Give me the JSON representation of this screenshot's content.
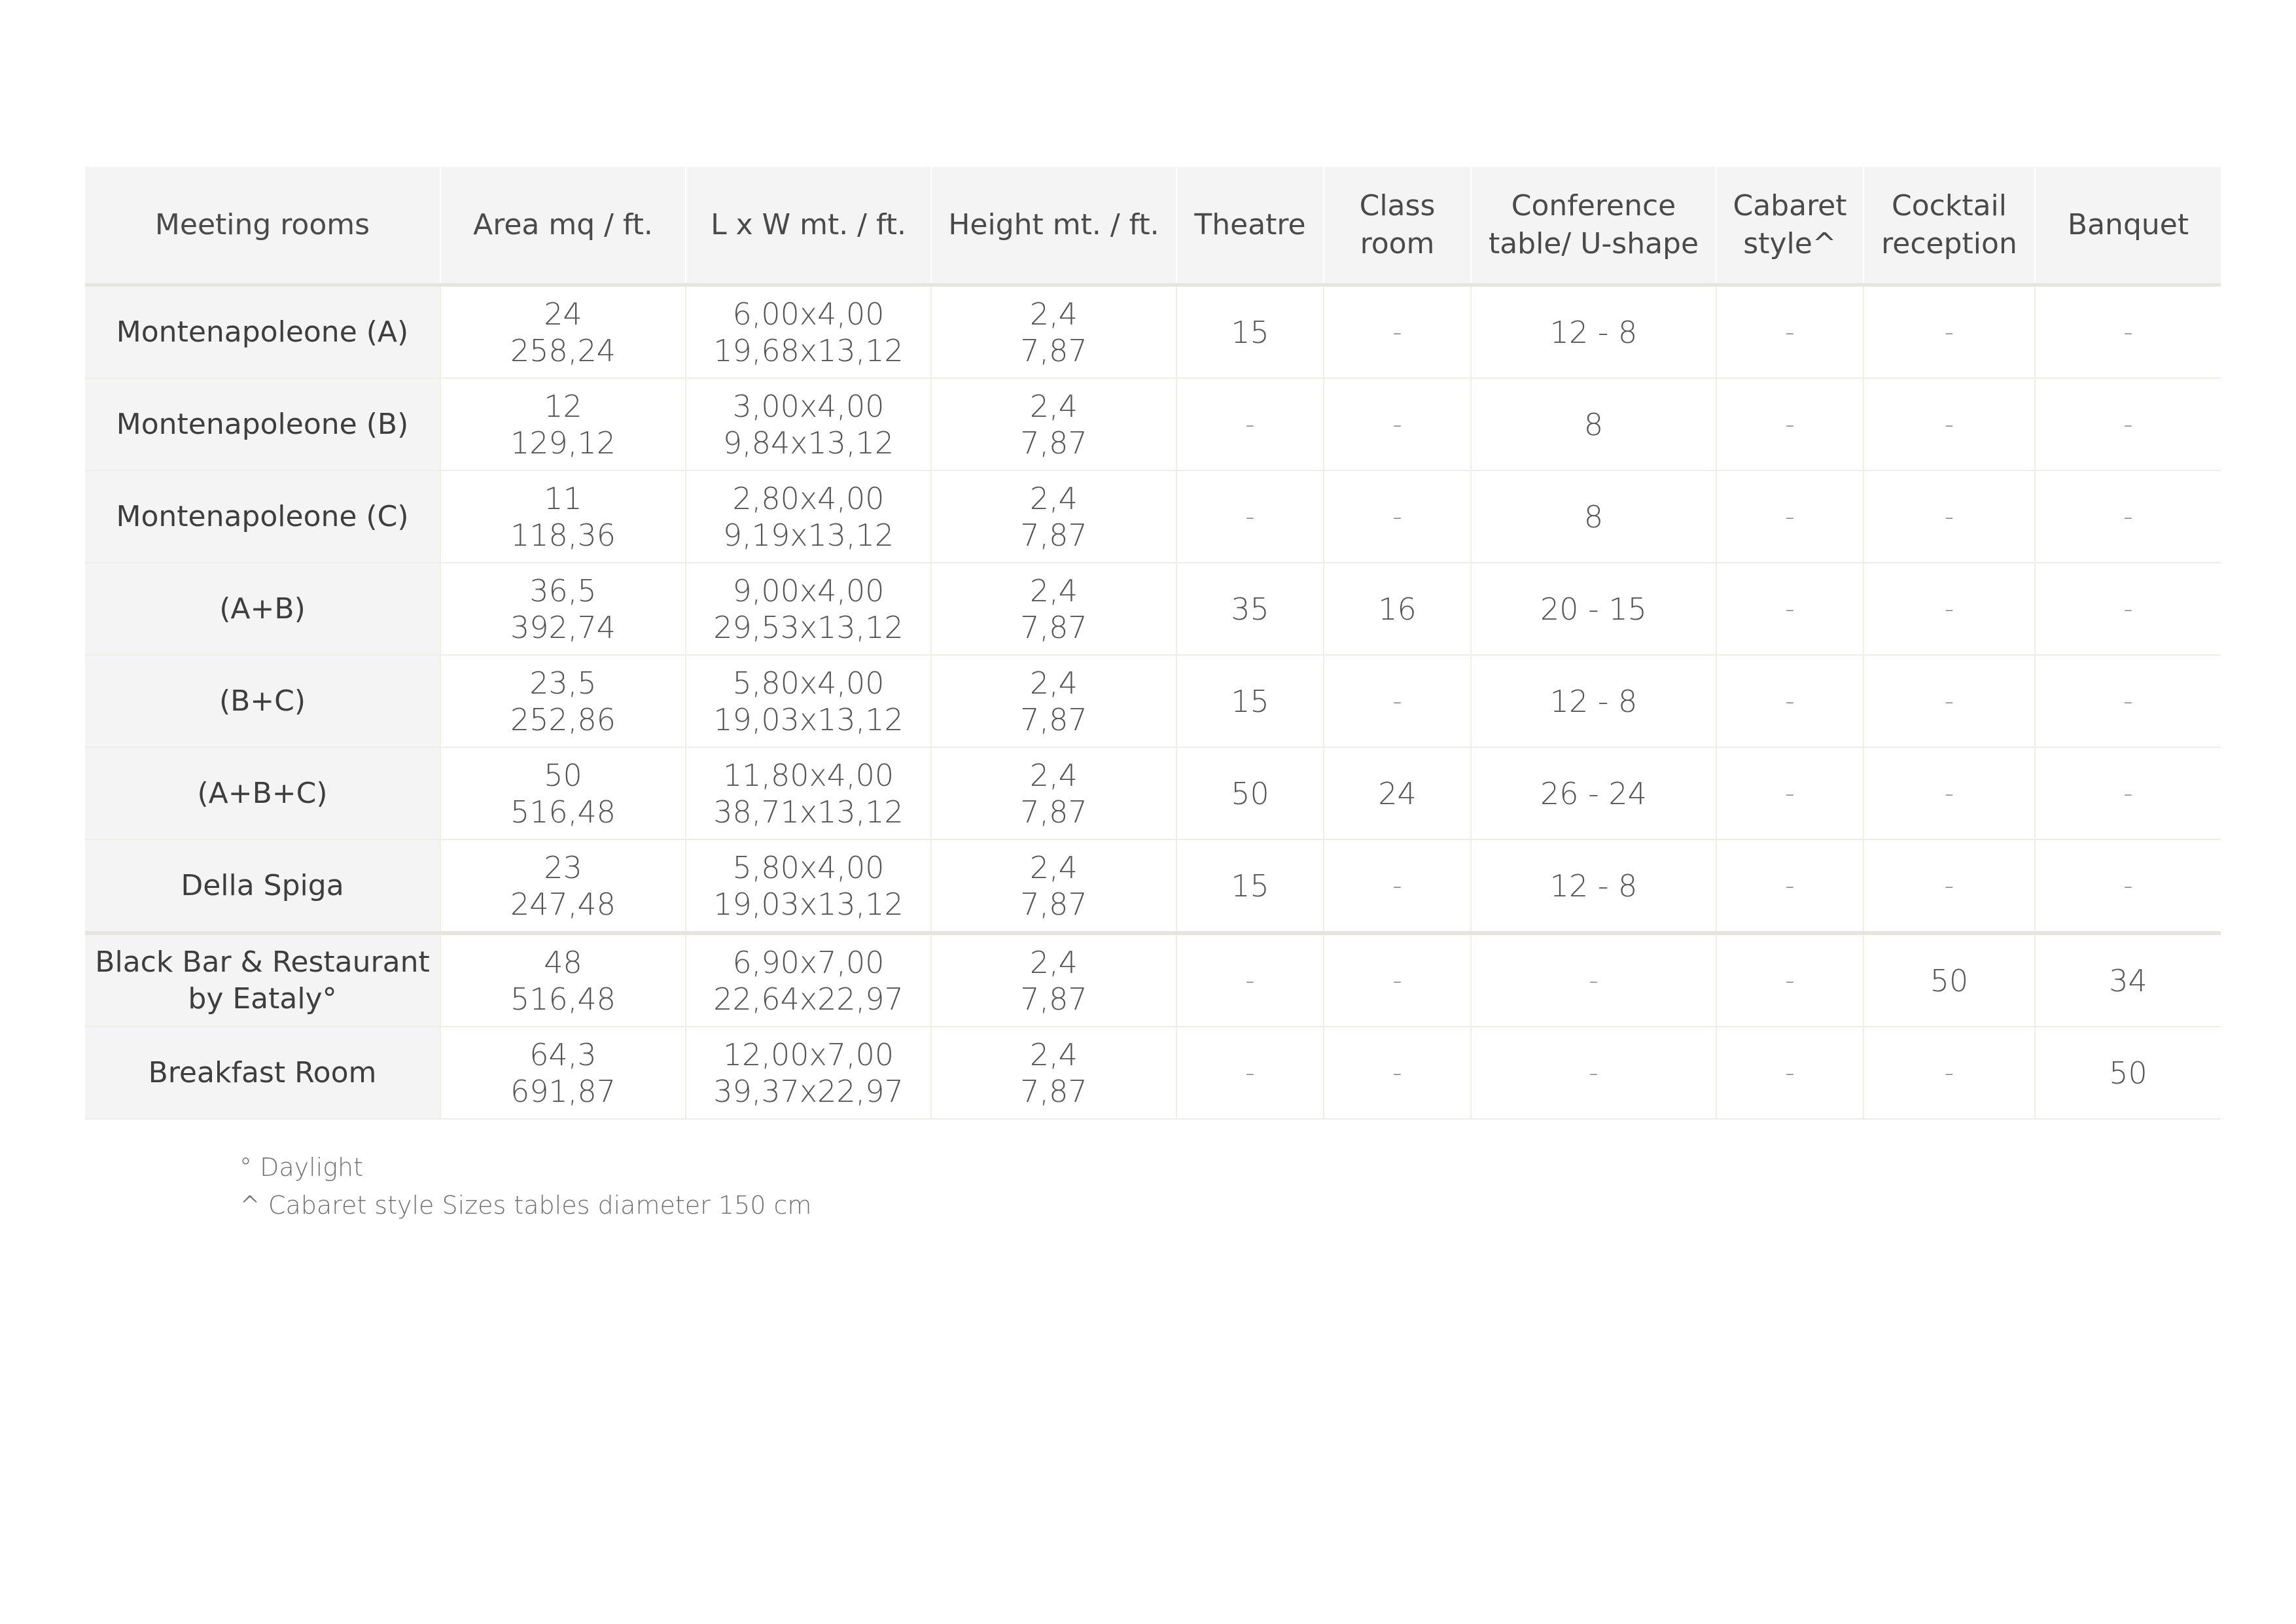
{
  "table": {
    "headers": [
      [
        "Meeting rooms"
      ],
      [
        "Area mq / ft."
      ],
      [
        "L x W mt. / ft."
      ],
      [
        "Height mt. / ft."
      ],
      [
        "Theatre"
      ],
      [
        "Class",
        "room"
      ],
      [
        "Conference",
        "table/ U-shape"
      ],
      [
        "Cabaret",
        "style^"
      ],
      [
        "Cocktail",
        "reception"
      ],
      [
        "Banquet"
      ]
    ],
    "rows": [
      {
        "name": [
          "Montenapoleone (A)"
        ],
        "area": [
          "24",
          "258,24"
        ],
        "lxw": [
          "6,00x4,00",
          "19,68x13,12"
        ],
        "height": [
          "2,4",
          "7,87"
        ],
        "theatre": "15",
        "classroom": "-",
        "conference": "12 - 8",
        "cabaret": "-",
        "cocktail": "-",
        "banquet": "-"
      },
      {
        "name": [
          "Montenapoleone (B)"
        ],
        "area": [
          "12",
          "129,12"
        ],
        "lxw": [
          "3,00x4,00",
          "9,84x13,12"
        ],
        "height": [
          "2,4",
          "7,87"
        ],
        "theatre": "-",
        "classroom": "-",
        "conference": "8",
        "cabaret": "-",
        "cocktail": "-",
        "banquet": "-"
      },
      {
        "name": [
          "Montenapoleone (C)"
        ],
        "area": [
          "11",
          "118,36"
        ],
        "lxw": [
          "2,80x4,00",
          "9,19x13,12"
        ],
        "height": [
          "2,4",
          "7,87"
        ],
        "theatre": "-",
        "classroom": "-",
        "conference": "8",
        "cabaret": "-",
        "cocktail": "-",
        "banquet": "-"
      },
      {
        "name": [
          "(A+B)"
        ],
        "area": [
          "36,5",
          "392,74"
        ],
        "lxw": [
          "9,00x4,00",
          "29,53x13,12"
        ],
        "height": [
          "2,4",
          "7,87"
        ],
        "theatre": "35",
        "classroom": "16",
        "conference": "20 - 15",
        "cabaret": "-",
        "cocktail": "-",
        "banquet": "-"
      },
      {
        "name": [
          "(B+C)"
        ],
        "area": [
          "23,5",
          "252,86"
        ],
        "lxw": [
          "5,80x4,00",
          "19,03x13,12"
        ],
        "height": [
          "2,4",
          "7,87"
        ],
        "theatre": "15",
        "classroom": "-",
        "conference": "12 - 8",
        "cabaret": "-",
        "cocktail": "-",
        "banquet": "-"
      },
      {
        "name": [
          "(A+B+C)"
        ],
        "area": [
          "50",
          "516,48"
        ],
        "lxw": [
          "11,80x4,00",
          "38,71x13,12"
        ],
        "height": [
          "2,4",
          "7,87"
        ],
        "theatre": "50",
        "classroom": "24",
        "conference": "26 - 24",
        "cabaret": "-",
        "cocktail": "-",
        "banquet": "-"
      },
      {
        "name": [
          "Della Spiga"
        ],
        "area": [
          "23",
          "247,48"
        ],
        "lxw": [
          "5,80x4,00",
          "19,03x13,12"
        ],
        "height": [
          "2,4",
          "7,87"
        ],
        "theatre": "15",
        "classroom": "-",
        "conference": "12 - 8",
        "cabaret": "-",
        "cocktail": "-",
        "banquet": "-"
      },
      {
        "name": [
          "Black Bar & Restaurant",
          "by Eataly°"
        ],
        "area": [
          "48",
          "516,48"
        ],
        "lxw": [
          "6,90x7,00",
          "22,64x22,97"
        ],
        "height": [
          "2,4",
          "7,87"
        ],
        "theatre": "-",
        "classroom": "-",
        "conference": "-",
        "cabaret": "-",
        "cocktail": "50",
        "banquet": "34"
      },
      {
        "name": [
          "Breakfast Room"
        ],
        "area": [
          "64,3",
          "691,87"
        ],
        "lxw": [
          "12,00x7,00",
          "39,37x22,97"
        ],
        "height": [
          "2,4",
          "7,87"
        ],
        "theatre": "-",
        "classroom": "-",
        "conference": "-",
        "cabaret": "-",
        "cocktail": "-",
        "banquet": "50"
      }
    ]
  },
  "notes": [
    "° Daylight",
    "^ Cabaret style Sizes tables diameter 150 cm"
  ]
}
